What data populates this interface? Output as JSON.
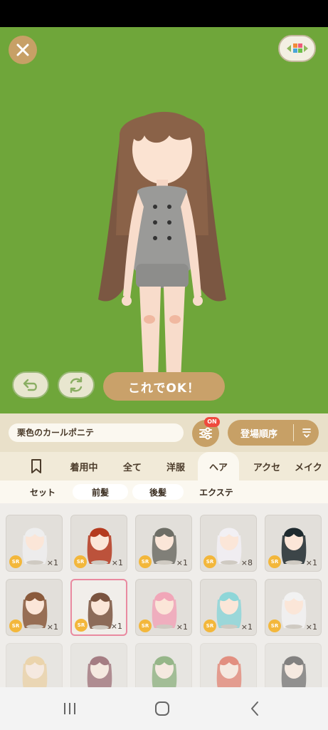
{
  "stage": {
    "background_color": "#6fa63a",
    "close_icon": "close-icon",
    "background_switch_icon": "palette-arrows-icon",
    "undo_icon": "undo-icon",
    "rotate_icon": "rotate-icon",
    "ok_label": "これでOK！"
  },
  "toolbar": {
    "item_name": "栗色のカールポニテ",
    "filter_badge": "ON",
    "sort_label": "登場順序"
  },
  "tabs": [
    {
      "label": "着用中"
    },
    {
      "label": "全て"
    },
    {
      "label": "洋服"
    },
    {
      "label": "ヘア",
      "active": true
    },
    {
      "label": "アクセ"
    },
    {
      "label": "メイク"
    }
  ],
  "subtabs": [
    {
      "label": "セット"
    },
    {
      "label": "前髪",
      "selected": true
    },
    {
      "label": "後髪",
      "selected": true
    },
    {
      "label": "エクステ"
    }
  ],
  "items": [
    {
      "rarity": "SR",
      "count": "×1",
      "hair_color": "#eeeeee"
    },
    {
      "rarity": "SR",
      "count": "×1",
      "hair_color": "#b53a1e"
    },
    {
      "rarity": "SR",
      "count": "×1",
      "hair_color": "#6e6e66"
    },
    {
      "rarity": "SR",
      "count": "×8",
      "hair_color": "#f2f0f4"
    },
    {
      "rarity": "SR",
      "count": "×1",
      "hair_color": "#1e2a2e"
    },
    {
      "rarity": "SR",
      "count": "×1",
      "hair_color": "#8a5a3c"
    },
    {
      "rarity": "SR",
      "count": "×1",
      "hair_color": "#7a5440",
      "selected": true
    },
    {
      "rarity": "SR",
      "count": "×1",
      "hair_color": "#f1a6b8"
    },
    {
      "rarity": "SR",
      "count": "×1",
      "hair_color": "#8ed6d8"
    },
    {
      "rarity": "SR",
      "count": "×1",
      "hair_color": "#f2f2f2"
    },
    {
      "rarity": "",
      "count": "",
      "hair_color": "#e8c07a"
    },
    {
      "rarity": "",
      "count": "",
      "hair_color": "#6a2230"
    },
    {
      "rarity": "",
      "count": "",
      "hair_color": "#4f8a3a"
    },
    {
      "rarity": "",
      "count": "",
      "hair_color": "#d8442a"
    },
    {
      "rarity": "",
      "count": "",
      "hair_color": "#2a2a2a"
    }
  ],
  "navbar": {
    "recents_icon": "recents-icon",
    "home_icon": "home-icon",
    "back_icon": "back-icon"
  }
}
